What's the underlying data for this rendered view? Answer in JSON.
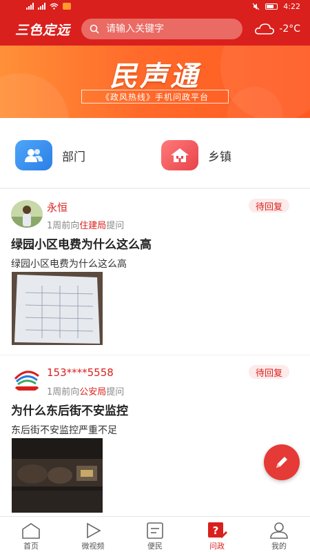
{
  "status_bar": {
    "time": "4:22"
  },
  "header": {
    "logo": "三色定远",
    "search_placeholder": "请输入关键字",
    "weather_icon": "cloud-icon",
    "temperature": "-2°C"
  },
  "banner": {
    "title": "民声通",
    "subtitle": "《政风热线》手机问政平台"
  },
  "categories": [
    {
      "label": "部门",
      "icon": "people-icon",
      "color": "#3b8ef0"
    },
    {
      "label": "乡镇",
      "icon": "house-icon",
      "color": "#ec5a5e"
    }
  ],
  "posts": [
    {
      "user": "永恒",
      "status": "待回复",
      "time_ago": "1周前向",
      "department": "住建局",
      "action": "提问",
      "title": "绿园小区电费为什么这么高",
      "body": "绿园小区电费为什么这么高"
    },
    {
      "user": "153****5558",
      "status": "待回复",
      "time_ago": "1周前向",
      "department": "公安局",
      "action": "提问",
      "title": "为什么东后街不安监控",
      "body": "东后街不安监控严重不足"
    }
  ],
  "nav": [
    {
      "label": "首页",
      "icon": "home-icon"
    },
    {
      "label": "微视频",
      "icon": "play-icon"
    },
    {
      "label": "便民",
      "icon": "document-icon"
    },
    {
      "label": "问政",
      "icon": "question-icon",
      "active": true
    },
    {
      "label": "我的",
      "icon": "user-icon"
    }
  ],
  "colors": {
    "brand_red": "#d9201d",
    "banner_orange": "#ff6a2a"
  }
}
